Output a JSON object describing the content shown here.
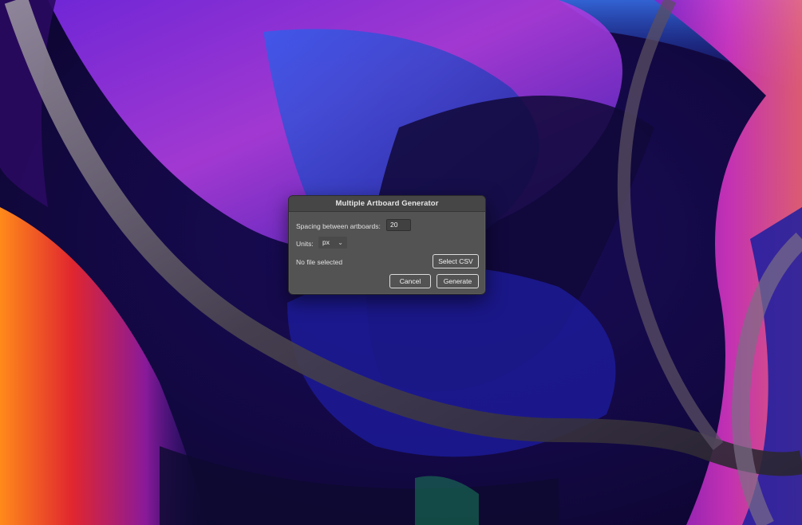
{
  "wallpaper": {
    "colors": {
      "deep_navy": "#0b0630",
      "violet": "#6a1fd8",
      "magenta": "#d62fd0",
      "blue": "#2145d6",
      "orange": "#ff7a1a",
      "red": "#d31a2a",
      "chrome": "#5a5560"
    }
  },
  "dialog": {
    "title": "Multiple Artboard Generator",
    "spacing_label": "Spacing between artboards:",
    "spacing_value": "20",
    "units_label": "Units:",
    "units_value": "px",
    "file_status": "No file selected",
    "select_csv_label": "Select CSV",
    "cancel_label": "Cancel",
    "generate_label": "Generate",
    "colors": {
      "background": "#535353",
      "titlebar": "#464646",
      "text": "#e0e0e0"
    }
  }
}
